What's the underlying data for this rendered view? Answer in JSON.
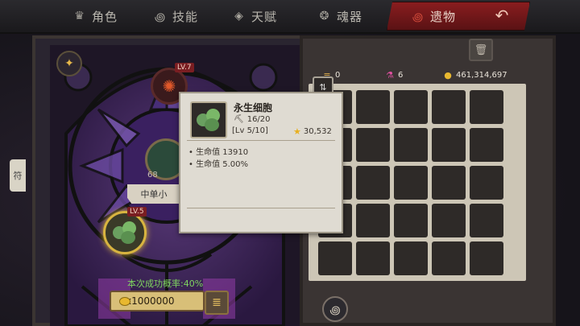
{
  "tabs": [
    {
      "label": "角色",
      "icon": "crown-icon",
      "active": false
    },
    {
      "label": "技能",
      "icon": "swirl-icon",
      "active": false
    },
    {
      "label": "天赋",
      "icon": "diamond-icon",
      "active": false
    },
    {
      "label": "魂器",
      "icon": "soul-icon",
      "active": false
    },
    {
      "label": "遗物",
      "icon": "relic-icon",
      "active": true
    }
  ],
  "colors": {
    "accent_red": "#8a1d1f",
    "gold": "#d8b440",
    "green_text": "#7fd460"
  },
  "left_panel": {
    "side_tab_label": "符",
    "top_slot_level": "LV.7",
    "center_slot_number": "68",
    "banner_label": "中单小",
    "selected_item_level": "LV.5",
    "success_rate": "本次成功概率:40%",
    "cost_label": "x1000000"
  },
  "resources": {
    "scroll_count": "0",
    "potion_count": "6",
    "gold_count": "461,314,697"
  },
  "inventory": {
    "rows": 5,
    "cols": 5
  },
  "tooltip": {
    "name": "永生细胞",
    "count": "16/20",
    "level": "[Lv 5/10]",
    "score": "30,532",
    "stats": [
      "• 生命值 13910",
      "• 生命值 5.00%"
    ]
  }
}
